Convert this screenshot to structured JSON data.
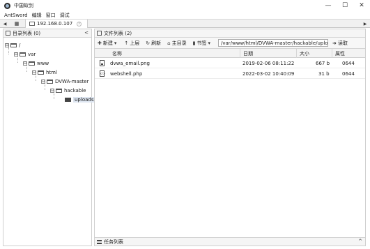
{
  "window": {
    "title": "中国蚁剑",
    "minimize_glyph": "—",
    "maximize_glyph": "☐",
    "close_glyph": "✕"
  },
  "menu": {
    "items": [
      "AntSword",
      "编辑",
      "窗口",
      "调试"
    ]
  },
  "tabs": {
    "left_arrow": "◀",
    "right_arrow": "▶",
    "home_glyph": "▦",
    "active_label": "192.168.0.107",
    "close_glyph": "×"
  },
  "dir_panel": {
    "title": "目录列表 (0)",
    "collapse_glyph": "<",
    "tree": [
      {
        "label": "/",
        "toggle": "⊟"
      },
      {
        "label": "var",
        "toggle": "⊟"
      },
      {
        "label": "www",
        "toggle": "⊟"
      },
      {
        "label": "html",
        "toggle": "⊟"
      },
      {
        "label": "DVWA-master",
        "toggle": "⊟"
      },
      {
        "label": "hackable",
        "toggle": "⊟"
      },
      {
        "label": "uploads",
        "toggle": ""
      }
    ]
  },
  "file_panel": {
    "title": "文件列表 (2)",
    "toolbar": {
      "new_label": "新建",
      "new_icon": "✚",
      "up_label": "上层",
      "up_icon": "↑",
      "refresh_label": "刷新",
      "refresh_icon": "↻",
      "home_label": "主目录",
      "home_icon": "⌂",
      "bookmark_label": "书签",
      "bookmark_icon": "▮",
      "dropdown_glyph": "▾",
      "path_value": "/var/www/html/DVWA-master/hackable/uploads/",
      "read_label": "读取",
      "read_icon": "➜"
    },
    "columns": [
      "名称",
      "日期",
      "大小",
      "属性"
    ],
    "files": [
      {
        "name": "dvwa_email.png",
        "date": "2019-02-06 08:11:22",
        "size": "667 b",
        "perm": "0644",
        "icon": "image-file-icon"
      },
      {
        "name": "webshell.php",
        "date": "2022-03-02 10:40:09",
        "size": "31 b",
        "perm": "0644",
        "icon": "code-file-icon"
      }
    ]
  },
  "task_panel": {
    "title": "任务列表",
    "toggle_glyph": "^"
  },
  "colors": {
    "panel_border": "#cfcfcf",
    "header_bg": "#f3f3f3",
    "selected_node_bg": "#dde5f0"
  }
}
